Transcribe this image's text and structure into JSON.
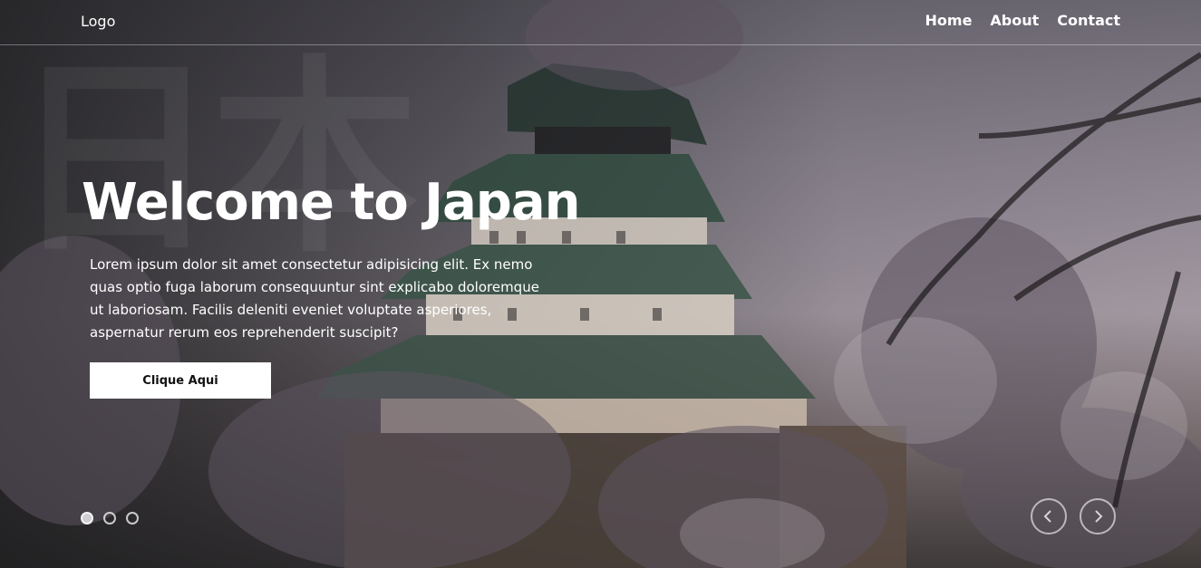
{
  "header": {
    "logo": "Logo",
    "nav": [
      "Home",
      "About",
      "Contact"
    ]
  },
  "hero": {
    "watermark": "日本",
    "title": "Welcome to Japan",
    "description": "Lorem ipsum dolor sit amet consectetur adipisicing elit. Ex nemo quas optio fuga laborum consequuntur sint explicabo doloremque ut laboriosam. Facilis deleniti eveniet voluptate asperiores, aspernatur rerum eos reprehenderit suscipit?",
    "button_label": "Clique Aqui"
  },
  "slider": {
    "dot_count": 3,
    "active_index": 0,
    "prev_icon": "chevron-left-icon",
    "next_icon": "chevron-right-icon"
  },
  "colors": {
    "button_bg": "#ffffff",
    "button_text": "#111111",
    "text": "#ffffff"
  }
}
